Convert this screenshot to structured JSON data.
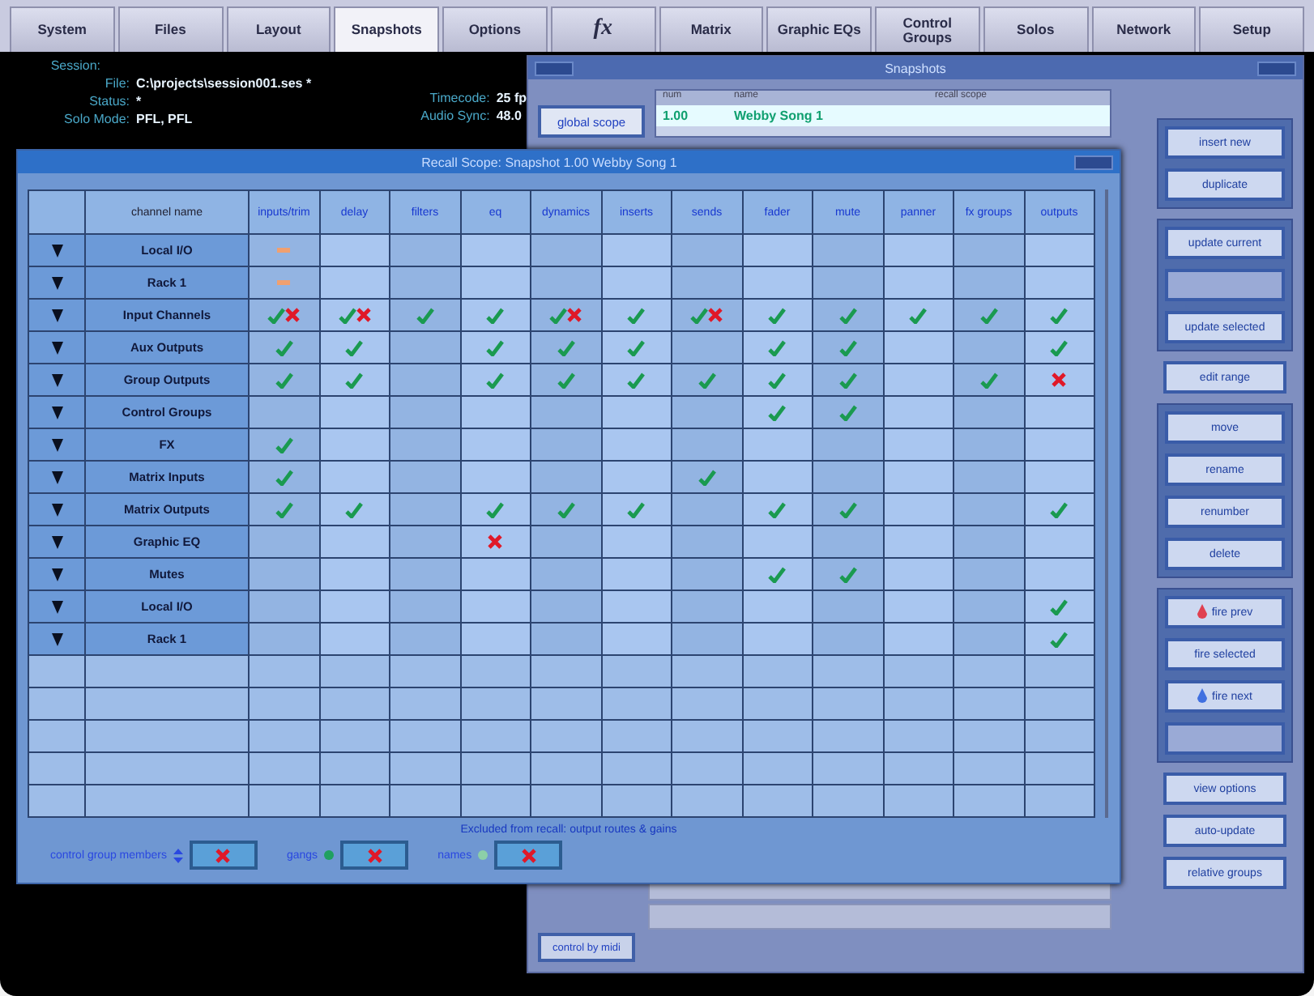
{
  "tabs": [
    {
      "label": "System",
      "selected": false
    },
    {
      "label": "Files",
      "selected": false
    },
    {
      "label": "Layout",
      "selected": false
    },
    {
      "label": "Snapshots",
      "selected": true
    },
    {
      "label": "Options",
      "selected": false
    },
    {
      "label": "fx",
      "selected": false,
      "kind": "symbol"
    },
    {
      "label": "Matrix",
      "selected": false
    },
    {
      "label": "Graphic EQs",
      "selected": false
    },
    {
      "label": "Control Groups",
      "selected": false
    },
    {
      "label": "Solos",
      "selected": false
    },
    {
      "label": "Network",
      "selected": false
    },
    {
      "label": "Setup",
      "selected": false
    }
  ],
  "session": {
    "heading": "Session:",
    "fields": [
      {
        "label": "File:",
        "value": "C:\\projects\\session001.ses *"
      },
      {
        "label": "Status:",
        "value": "*"
      },
      {
        "label": "Solo Mode:",
        "value": "PFL, PFL"
      }
    ],
    "sync": [
      {
        "label": "Timecode:",
        "value": "25 fp"
      },
      {
        "label": "Audio Sync:",
        "value": "48.0"
      }
    ]
  },
  "snapshots": {
    "title": "Snapshots",
    "global_scope": "global scope",
    "columns": [
      "num",
      "name",
      "recall scope"
    ],
    "rows": [
      {
        "num": "1.00",
        "name": "Webby Song 1",
        "selected": true
      }
    ],
    "control_by_midi": "control by midi",
    "buttons": [
      {
        "label": "insert new",
        "disabled": false,
        "kind": "plain"
      },
      {
        "label": "duplicate",
        "disabled": false,
        "kind": "plain"
      },
      {
        "label": "update current",
        "disabled": false,
        "kind": "plain"
      },
      {
        "disabled": true,
        "kind": "plain"
      },
      {
        "label": "update selected",
        "disabled": false,
        "kind": "plain"
      },
      {
        "label": "edit range",
        "disabled": false,
        "kind": "plain"
      },
      {
        "label": "move",
        "disabled": false,
        "kind": "plain"
      },
      {
        "label": "rename",
        "disabled": false,
        "kind": "plain"
      },
      {
        "label": "renumber",
        "disabled": false,
        "kind": "plain"
      },
      {
        "label": "delete",
        "disabled": false,
        "kind": "plain"
      },
      {
        "label": "fire prev",
        "disabled": false,
        "kind": "prev"
      },
      {
        "label": "fire selected",
        "disabled": false,
        "kind": "plain"
      },
      {
        "label": "fire next",
        "disabled": false,
        "kind": "next"
      },
      {
        "disabled": true,
        "kind": "plain"
      },
      {
        "label": "view options",
        "disabled": false,
        "kind": "plain"
      },
      {
        "label": "auto-update",
        "disabled": false,
        "kind": "plain"
      },
      {
        "label": "relative groups",
        "disabled": false,
        "kind": "plain"
      }
    ]
  },
  "recall_scope": {
    "title": "Recall Scope: Snapshot 1.00 Webby Song 1",
    "columns": [
      "channel name",
      "inputs/trim",
      "delay",
      "filters",
      "eq",
      "dynamics",
      "inserts",
      "sends",
      "fader",
      "mute",
      "panner",
      "fx groups",
      "outputs"
    ],
    "rows": [
      {
        "name": "Local I/O",
        "cells": [
          {
            "kind": "partial"
          },
          {
            "kind": "none"
          },
          {
            "kind": "none"
          },
          {
            "kind": "none"
          },
          {
            "kind": "none"
          },
          {
            "kind": "none"
          },
          {
            "kind": "none"
          },
          {
            "kind": "none"
          },
          {
            "kind": "none"
          },
          {
            "kind": "none"
          },
          {
            "kind": "none"
          },
          {
            "kind": "none"
          }
        ]
      },
      {
        "name": "Rack 1",
        "cells": [
          {
            "kind": "partial"
          },
          {
            "kind": "none"
          },
          {
            "kind": "none"
          },
          {
            "kind": "none"
          },
          {
            "kind": "none"
          },
          {
            "kind": "none"
          },
          {
            "kind": "none"
          },
          {
            "kind": "none"
          },
          {
            "kind": "none"
          },
          {
            "kind": "none"
          },
          {
            "kind": "none"
          },
          {
            "kind": "none"
          }
        ]
      },
      {
        "name": "Input Channels",
        "cells": [
          {
            "kind": "both"
          },
          {
            "kind": "both"
          },
          {
            "kind": "check"
          },
          {
            "kind": "check"
          },
          {
            "kind": "both"
          },
          {
            "kind": "check"
          },
          {
            "kind": "both"
          },
          {
            "kind": "check"
          },
          {
            "kind": "check"
          },
          {
            "kind": "check"
          },
          {
            "kind": "check"
          },
          {
            "kind": "check"
          }
        ]
      },
      {
        "name": "Aux Outputs",
        "cells": [
          {
            "kind": "check"
          },
          {
            "kind": "check"
          },
          {
            "kind": "none"
          },
          {
            "kind": "check"
          },
          {
            "kind": "check"
          },
          {
            "kind": "check"
          },
          {
            "kind": "none"
          },
          {
            "kind": "check"
          },
          {
            "kind": "check"
          },
          {
            "kind": "none"
          },
          {
            "kind": "none"
          },
          {
            "kind": "check"
          }
        ]
      },
      {
        "name": "Group Outputs",
        "cells": [
          {
            "kind": "check"
          },
          {
            "kind": "check"
          },
          {
            "kind": "none"
          },
          {
            "kind": "check"
          },
          {
            "kind": "check"
          },
          {
            "kind": "check"
          },
          {
            "kind": "check"
          },
          {
            "kind": "check"
          },
          {
            "kind": "check"
          },
          {
            "kind": "none"
          },
          {
            "kind": "check"
          },
          {
            "kind": "cross"
          }
        ]
      },
      {
        "name": "Control Groups",
        "cells": [
          {
            "kind": "none"
          },
          {
            "kind": "none"
          },
          {
            "kind": "none"
          },
          {
            "kind": "none"
          },
          {
            "kind": "none"
          },
          {
            "kind": "none"
          },
          {
            "kind": "none"
          },
          {
            "kind": "check"
          },
          {
            "kind": "check"
          },
          {
            "kind": "none"
          },
          {
            "kind": "none"
          },
          {
            "kind": "none"
          }
        ]
      },
      {
        "name": "FX",
        "cells": [
          {
            "kind": "check"
          },
          {
            "kind": "none"
          },
          {
            "kind": "none"
          },
          {
            "kind": "none"
          },
          {
            "kind": "none"
          },
          {
            "kind": "none"
          },
          {
            "kind": "none"
          },
          {
            "kind": "none"
          },
          {
            "kind": "none"
          },
          {
            "kind": "none"
          },
          {
            "kind": "none"
          },
          {
            "kind": "none"
          }
        ]
      },
      {
        "name": "Matrix Inputs",
        "cells": [
          {
            "kind": "check"
          },
          {
            "kind": "none"
          },
          {
            "kind": "none"
          },
          {
            "kind": "none"
          },
          {
            "kind": "none"
          },
          {
            "kind": "none"
          },
          {
            "kind": "check"
          },
          {
            "kind": "none"
          },
          {
            "kind": "none"
          },
          {
            "kind": "none"
          },
          {
            "kind": "none"
          },
          {
            "kind": "none"
          }
        ]
      },
      {
        "name": "Matrix Outputs",
        "cells": [
          {
            "kind": "check"
          },
          {
            "kind": "check"
          },
          {
            "kind": "none"
          },
          {
            "kind": "check"
          },
          {
            "kind": "check"
          },
          {
            "kind": "check"
          },
          {
            "kind": "none"
          },
          {
            "kind": "check"
          },
          {
            "kind": "check"
          },
          {
            "kind": "none"
          },
          {
            "kind": "none"
          },
          {
            "kind": "check"
          }
        ]
      },
      {
        "name": "Graphic EQ",
        "cells": [
          {
            "kind": "none"
          },
          {
            "kind": "none"
          },
          {
            "kind": "none"
          },
          {
            "kind": "cross"
          },
          {
            "kind": "none"
          },
          {
            "kind": "none"
          },
          {
            "kind": "none"
          },
          {
            "kind": "none"
          },
          {
            "kind": "none"
          },
          {
            "kind": "none"
          },
          {
            "kind": "none"
          },
          {
            "kind": "none"
          }
        ]
      },
      {
        "name": "Mutes",
        "cells": [
          {
            "kind": "none"
          },
          {
            "kind": "none"
          },
          {
            "kind": "none"
          },
          {
            "kind": "none"
          },
          {
            "kind": "none"
          },
          {
            "kind": "none"
          },
          {
            "kind": "none"
          },
          {
            "kind": "check"
          },
          {
            "kind": "check"
          },
          {
            "kind": "none"
          },
          {
            "kind": "none"
          },
          {
            "kind": "none"
          }
        ]
      },
      {
        "name": "Local I/O",
        "cells": [
          {
            "kind": "none"
          },
          {
            "kind": "none"
          },
          {
            "kind": "none"
          },
          {
            "kind": "none"
          },
          {
            "kind": "none"
          },
          {
            "kind": "none"
          },
          {
            "kind": "none"
          },
          {
            "kind": "none"
          },
          {
            "kind": "none"
          },
          {
            "kind": "none"
          },
          {
            "kind": "none"
          },
          {
            "kind": "check"
          }
        ]
      },
      {
        "name": "Rack 1",
        "cells": [
          {
            "kind": "none"
          },
          {
            "kind": "none"
          },
          {
            "kind": "none"
          },
          {
            "kind": "none"
          },
          {
            "kind": "none"
          },
          {
            "kind": "none"
          },
          {
            "kind": "none"
          },
          {
            "kind": "none"
          },
          {
            "kind": "none"
          },
          {
            "kind": "none"
          },
          {
            "kind": "none"
          },
          {
            "kind": "check"
          }
        ]
      }
    ],
    "excluded_title": "Excluded from recall: output routes & gains",
    "excluded": [
      {
        "label": "control group members",
        "excluded": true
      },
      {
        "label": "gangs",
        "excluded": true
      },
      {
        "label": "names",
        "excluded": true
      }
    ]
  }
}
